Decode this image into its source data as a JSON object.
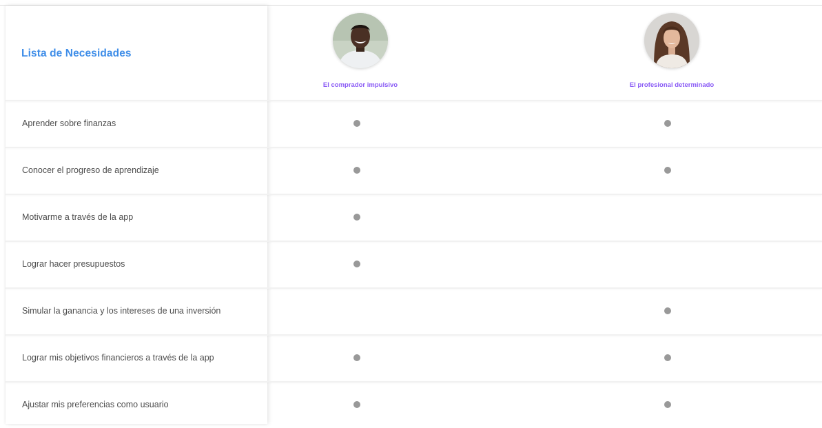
{
  "header": {
    "title": "Lista de Necesidades"
  },
  "personas": [
    {
      "name": "El comprador impulsivo",
      "avatar_icon": "man-portrait"
    },
    {
      "name": "El profesional determinado",
      "avatar_icon": "woman-portrait"
    }
  ],
  "rows": [
    {
      "label": "Aprender sobre finanzas",
      "marks": [
        true,
        true
      ]
    },
    {
      "label": "Conocer el progreso de aprendizaje",
      "marks": [
        true,
        true
      ]
    },
    {
      "label": "Motivarme a través de la app",
      "marks": [
        true,
        false
      ]
    },
    {
      "label": "Lograr hacer presupuestos",
      "marks": [
        true,
        false
      ]
    },
    {
      "label": "Simular la ganancia y los intereses de una inversión",
      "marks": [
        false,
        true
      ]
    },
    {
      "label": "Lograr mis objetivos financieros a través de la app",
      "marks": [
        true,
        true
      ]
    },
    {
      "label": "Ajustar mis preferencias como usuario",
      "marks": [
        true,
        true
      ]
    }
  ],
  "colors": {
    "title": "#3e8de8",
    "persona_name": "#8b5cf6",
    "dot": "#999999",
    "label": "#4d4d4d"
  }
}
